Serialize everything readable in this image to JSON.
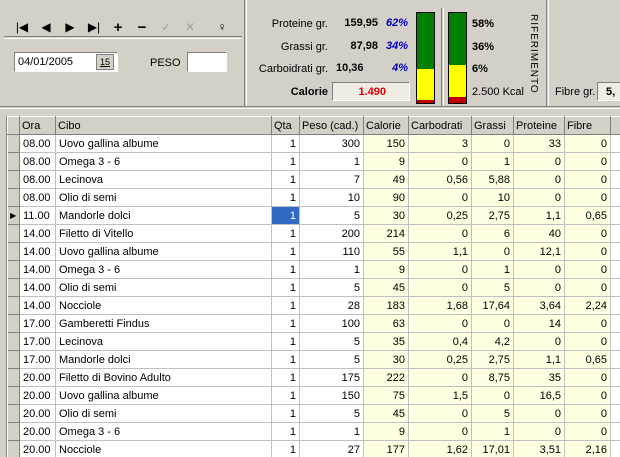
{
  "nav": {
    "first_icon": "first-record-icon",
    "prev_icon": "prev-record-icon",
    "next_icon": "next-record-icon",
    "last_icon": "last-record-icon",
    "add_icon": "plus-icon",
    "delete_icon": "minus-icon",
    "confirm_icon": "checkmark-icon",
    "cancel_icon": "x-icon",
    "refresh_icon": "refresh-icon",
    "glyphs": {
      "first": "|◀",
      "prev": "◀",
      "next": "▶",
      "last": "▶|",
      "add": "+",
      "delete": "−",
      "confirm": "✓",
      "cancel": "✕",
      "refresh": "♀"
    }
  },
  "filter": {
    "date_value": "04/01/2005",
    "calendar_label": "15",
    "peso_label": "PESO",
    "peso_value": ""
  },
  "summary": {
    "proteine": {
      "label": "Proteine gr.",
      "value": "159,95",
      "pct": "62%"
    },
    "grassi": {
      "label": "Grassi gr.",
      "value": "87,98",
      "pct": "34%"
    },
    "carbo": {
      "label": "Carboidrati gr.",
      "value": "10,36",
      "pct": "4%"
    },
    "calorie": {
      "label": "Calorie",
      "value": "1.490"
    }
  },
  "bars": {
    "current": {
      "protein_frac": 0.62,
      "fat_frac": 0.34,
      "carb_frac": 0.04
    },
    "reference": {
      "protein_pct": "58%",
      "fat_pct": "36%",
      "carb_pct": "6%",
      "protein_frac": 0.58,
      "fat_frac": 0.36,
      "carb_frac": 0.06,
      "kcal": "2.500 Kcal",
      "title": "RIFERIMENTO"
    },
    "colors": {
      "protein": "#008000",
      "fat": "#ffff00",
      "carb": "#c00000"
    }
  },
  "fibre": {
    "label": "Fibre gr.",
    "value": "5,"
  },
  "table": {
    "headers": [
      "Ora",
      "Cibo",
      "Qta",
      "Peso (cad.)",
      "Calorie",
      "Carbodrati",
      "Grassi",
      "Proteine",
      "Fibre"
    ],
    "rows": [
      [
        "08.00",
        "Uovo gallina albume",
        "1",
        "300",
        "150",
        "3",
        "0",
        "33",
        "0"
      ],
      [
        "08.00",
        "Omega 3 - 6",
        "1",
        "1",
        "9",
        "0",
        "1",
        "0",
        "0"
      ],
      [
        "08.00",
        "Lecinova",
        "1",
        "7",
        "49",
        "0,56",
        "5,88",
        "0",
        "0"
      ],
      [
        "08.00",
        "Olio di semi",
        "1",
        "10",
        "90",
        "0",
        "10",
        "0",
        "0"
      ],
      [
        "11.00",
        "Mandorle dolci",
        "1",
        "5",
        "30",
        "0,25",
        "2,75",
        "1,1",
        "0,65"
      ],
      [
        "14.00",
        "Filetto di Vitello",
        "1",
        "200",
        "214",
        "0",
        "6",
        "40",
        "0"
      ],
      [
        "14.00",
        "Uovo gallina albume",
        "1",
        "110",
        "55",
        "1,1",
        "0",
        "12,1",
        "0"
      ],
      [
        "14.00",
        "Omega 3 - 6",
        "1",
        "1",
        "9",
        "0",
        "1",
        "0",
        "0"
      ],
      [
        "14.00",
        "Olio di semi",
        "1",
        "5",
        "45",
        "0",
        "5",
        "0",
        "0"
      ],
      [
        "14.00",
        "Nocciole",
        "1",
        "28",
        "183",
        "1,68",
        "17,64",
        "3,64",
        "2,24"
      ],
      [
        "17.00",
        "Gamberetti Findus",
        "1",
        "100",
        "63",
        "0",
        "0",
        "14",
        "0"
      ],
      [
        "17.00",
        "Lecinova",
        "1",
        "5",
        "35",
        "0,4",
        "4,2",
        "0",
        "0"
      ],
      [
        "17.00",
        "Mandorle dolci",
        "1",
        "5",
        "30",
        "0,25",
        "2,75",
        "1,1",
        "0,65"
      ],
      [
        "20.00",
        "Filetto di Bovino Adulto",
        "1",
        "175",
        "222",
        "0",
        "8,75",
        "35",
        "0"
      ],
      [
        "20.00",
        "Uovo gallina albume",
        "1",
        "150",
        "75",
        "1,5",
        "0",
        "16,5",
        "0"
      ],
      [
        "20.00",
        "Olio di semi",
        "1",
        "5",
        "45",
        "0",
        "5",
        "0",
        "0"
      ],
      [
        "20.00",
        "Omega 3 - 6",
        "1",
        "1",
        "9",
        "0",
        "1",
        "0",
        "0"
      ],
      [
        "20.00",
        "Nocciole",
        "1",
        "27",
        "177",
        "1,62",
        "17,01",
        "3,51",
        "2,16"
      ]
    ],
    "current_row": 4
  }
}
